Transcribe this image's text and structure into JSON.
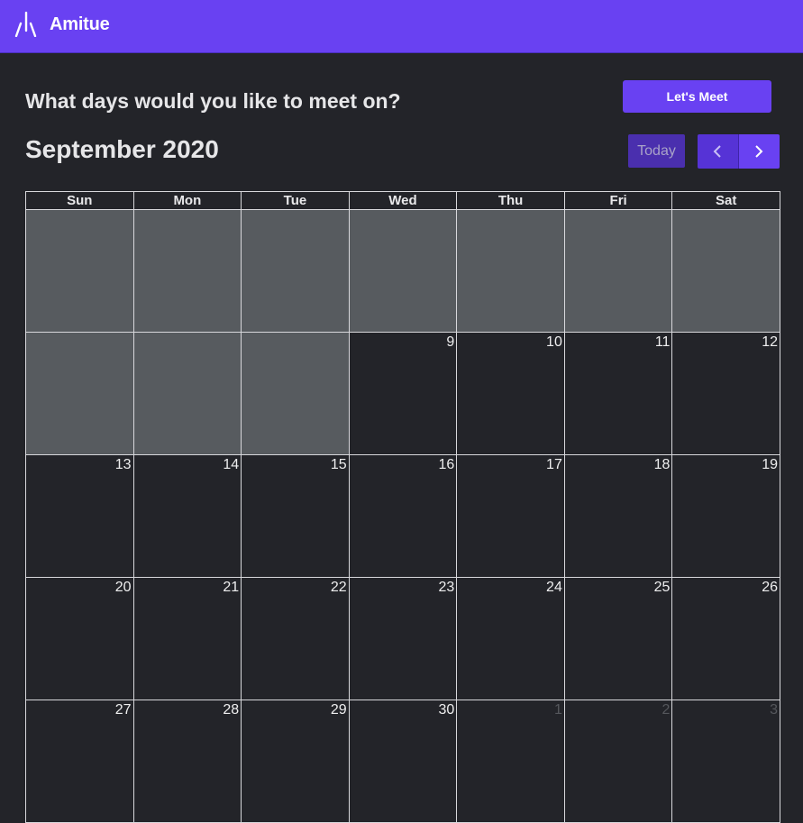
{
  "app": {
    "title": "Amitue",
    "logo_icon": "amitue-logo-icon"
  },
  "colors": {
    "brand": "#6941f2",
    "background": "#232429",
    "disabled_day": "#575b5f"
  },
  "header": {
    "question": "What days would you like to meet on?",
    "meet_button": "Let's Meet",
    "month_title": "September 2020",
    "today_button": "Today",
    "prev_icon": "chevron-left-icon",
    "next_icon": "chevron-right-icon"
  },
  "calendar": {
    "weekdays": [
      "Sun",
      "Mon",
      "Tue",
      "Wed",
      "Thu",
      "Fri",
      "Sat"
    ],
    "weeks": [
      [
        {
          "label": "",
          "state": "disabled"
        },
        {
          "label": "",
          "state": "disabled"
        },
        {
          "label": "",
          "state": "disabled"
        },
        {
          "label": "",
          "state": "disabled"
        },
        {
          "label": "",
          "state": "disabled"
        },
        {
          "label": "",
          "state": "disabled"
        },
        {
          "label": "",
          "state": "disabled"
        }
      ],
      [
        {
          "label": "",
          "state": "disabled"
        },
        {
          "label": "",
          "state": "disabled"
        },
        {
          "label": "",
          "state": "disabled"
        },
        {
          "label": "9",
          "state": "active"
        },
        {
          "label": "10",
          "state": "active"
        },
        {
          "label": "11",
          "state": "active"
        },
        {
          "label": "12",
          "state": "active"
        }
      ],
      [
        {
          "label": "13",
          "state": "active"
        },
        {
          "label": "14",
          "state": "active"
        },
        {
          "label": "15",
          "state": "active"
        },
        {
          "label": "16",
          "state": "active"
        },
        {
          "label": "17",
          "state": "active"
        },
        {
          "label": "18",
          "state": "active"
        },
        {
          "label": "19",
          "state": "active"
        }
      ],
      [
        {
          "label": "20",
          "state": "active"
        },
        {
          "label": "21",
          "state": "active"
        },
        {
          "label": "22",
          "state": "active"
        },
        {
          "label": "23",
          "state": "active"
        },
        {
          "label": "24",
          "state": "active"
        },
        {
          "label": "25",
          "state": "active"
        },
        {
          "label": "26",
          "state": "active"
        }
      ],
      [
        {
          "label": "27",
          "state": "active"
        },
        {
          "label": "28",
          "state": "active"
        },
        {
          "label": "29",
          "state": "active"
        },
        {
          "label": "30",
          "state": "active"
        },
        {
          "label": "1",
          "state": "other"
        },
        {
          "label": "2",
          "state": "other"
        },
        {
          "label": "3",
          "state": "other"
        }
      ]
    ]
  }
}
